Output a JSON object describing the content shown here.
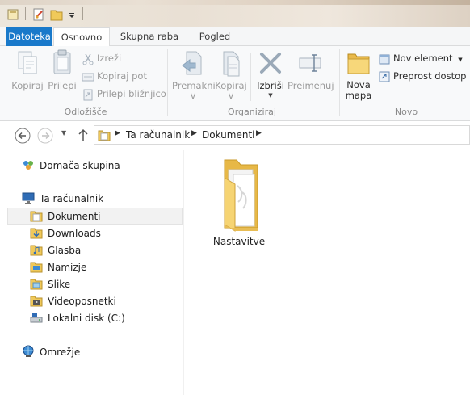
{
  "ribbon_tabs": [
    {
      "label": "Datoteka"
    },
    {
      "label": "Osnovno"
    },
    {
      "label": "Skupna raba"
    },
    {
      "label": "Pogled"
    }
  ],
  "ribbon": {
    "clipboard": {
      "copy": "Kopiraj",
      "paste": "Prilepi",
      "cut": "Izreži",
      "copy_path": "Kopiraj pot",
      "paste_shortcut": "Prilepi bližnjico",
      "label": "Odložišče"
    },
    "organize": {
      "move_to": "Premakni",
      "move_to_arrow": "v",
      "copy_to": "Kopiraj",
      "copy_to_arrow": "v",
      "delete": "Izbriši",
      "rename": "Preimenuj",
      "label": "Organiziraj"
    },
    "new": {
      "new_folder_line1": "Nova",
      "new_folder_line2": "mapa",
      "new_item": "Nov element",
      "easy_access": "Preprost dostop",
      "label": "Novo"
    }
  },
  "address": {
    "crumbs": [
      "Ta računalnik",
      "Dokumenti"
    ]
  },
  "navpane": {
    "homegroup": "Domača skupina",
    "this_pc": "Ta računalnik",
    "items": [
      {
        "label": "Dokumenti",
        "icon": "documents-folder-icon"
      },
      {
        "label": "Downloads",
        "icon": "downloads-folder-icon"
      },
      {
        "label": "Glasba",
        "icon": "music-folder-icon"
      },
      {
        "label": "Namizje",
        "icon": "desktop-folder-icon"
      },
      {
        "label": "Slike",
        "icon": "pictures-folder-icon"
      },
      {
        "label": "Videoposnetki",
        "icon": "videos-folder-icon"
      },
      {
        "label": "Lokalni disk (C:)",
        "icon": "drive-icon"
      }
    ],
    "network": "Omrežje"
  },
  "content": {
    "items": [
      {
        "name": "Nastavitve",
        "icon": "folder-icon"
      }
    ]
  },
  "colors": {
    "file_tab": "#1979ca",
    "folder_yellow": "#f3d37d"
  }
}
